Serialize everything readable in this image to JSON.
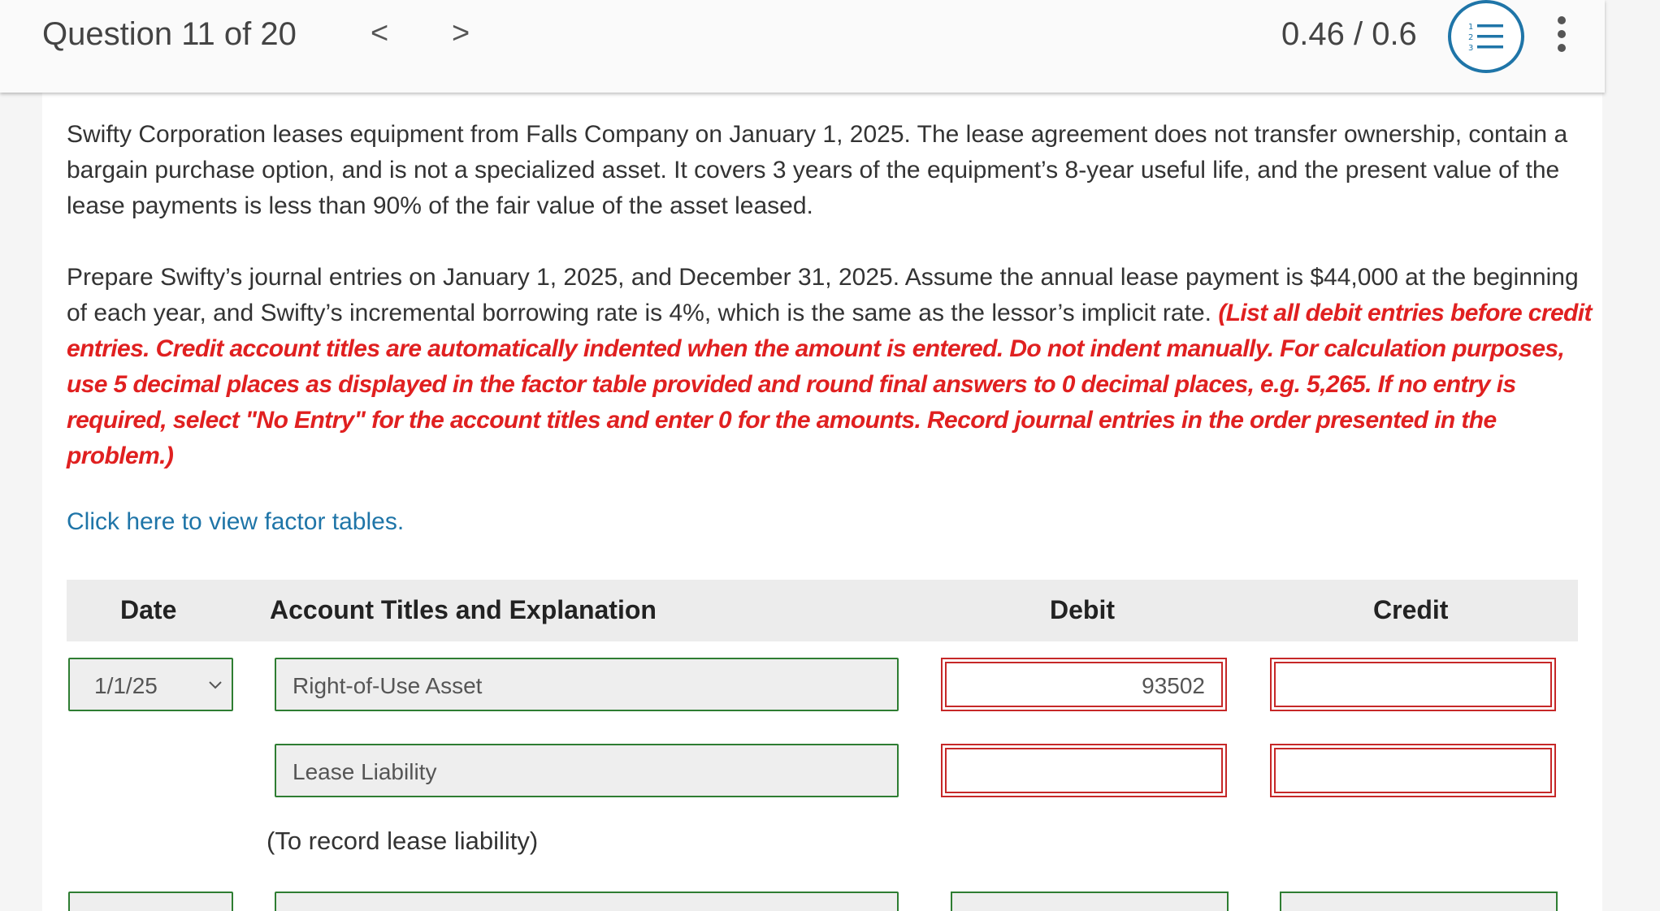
{
  "header": {
    "question_label": "Question 11 of 20",
    "prev_glyph": "<",
    "next_glyph": ">",
    "score": "0.46 / 0.6"
  },
  "problem": {
    "paragraph1": "Swifty Corporation leases equipment from Falls Company on January 1, 2025. The lease agreement does not transfer ownership, contain a bargain purchase option, and is not a specialized asset. It covers 3 years of the equipment’s 8-year useful life, and the present value of the lease payments is less than 90% of the fair value of the asset leased.",
    "paragraph2": "Prepare Swifty’s journal entries on January 1, 2025, and December 31, 2025. Assume the annual lease payment is $44,000 at the beginning of each year, and Swifty’s incremental borrowing rate is 4%, which is the same as the lessor’s implicit rate.",
    "instructions": "(List all debit entries before credit entries. Credit account titles are automatically indented when the amount is entered. Do not indent manually. For calculation purposes, use 5 decimal places as displayed in the factor table provided and round final answers to 0 decimal places, e.g. 5,265. If no entry is required, select \"No Entry\" for the account titles and enter 0 for the amounts. Record journal entries in the order presented in the problem.)",
    "factor_link": "Click here to view factor tables."
  },
  "table": {
    "headers": {
      "date": "Date",
      "account": "Account Titles and Explanation",
      "debit": "Debit",
      "credit": "Credit"
    },
    "rows": [
      {
        "date": "1/1/25",
        "account": "Right-of-Use Asset",
        "debit": "93502",
        "credit": ""
      },
      {
        "date": "",
        "account": "Lease Liability",
        "debit": "",
        "credit": ""
      }
    ],
    "note": "(To record lease liability)"
  },
  "colors": {
    "accent_blue": "#1f75a8",
    "error_red": "#c62828",
    "valid_green": "#2e7d32",
    "instruction_red": "#e02020"
  },
  "icons": {
    "list": "numbered-list-icon",
    "more": "more-vertical-icon",
    "dropdown": "chevron-down-icon"
  }
}
